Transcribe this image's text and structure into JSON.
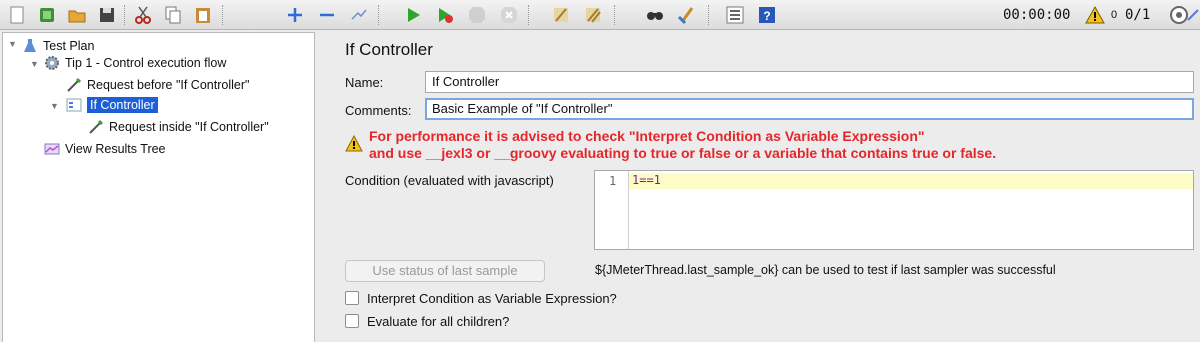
{
  "toolbar": {
    "icons": [
      "new-icon",
      "templates-icon",
      "open-icon",
      "save-icon",
      "cut-icon",
      "copy-icon",
      "paste-icon",
      "expand-icon",
      "collapse-icon",
      "toggle-icon",
      "start-icon",
      "start-no-pause-icon",
      "stop-icon",
      "shutdown-icon",
      "clear-icon",
      "clear-all-icon",
      "search-icon",
      "reset-search-icon",
      "function-helper-icon",
      "help-icon"
    ],
    "timer": "00:00:00",
    "warning_count": "0",
    "threads": "0/1"
  },
  "tree": {
    "items": [
      {
        "label": "Test Plan"
      },
      {
        "label": "Tip 1 - Control execution flow"
      },
      {
        "label": "Request before \"If Controller\""
      },
      {
        "label": "If Controller",
        "selected": true
      },
      {
        "label": "Request inside \"If Controller\""
      },
      {
        "label": "View Results Tree"
      }
    ]
  },
  "panel": {
    "title": "If Controller",
    "name_label": "Name:",
    "name_value": "If Controller",
    "comments_label": "Comments:",
    "comments_value": "Basic Example of \"If Controller\"",
    "warning_line1": "For performance it is advised to check \"Interpret Condition as Variable Expression\"",
    "warning_line2": "and use __jexl3 or __groovy evaluating to true or false or a variable that contains true or false.",
    "condition_label": "Condition (evaluated with javascript)",
    "condition_line_number": "1",
    "condition_code": "1==1",
    "use_status_button": "Use status of last sample",
    "hint_text": "${JMeterThread.last_sample_ok} can be used to test if last sampler was successful",
    "checkbox_interpret": "Interpret Condition as Variable Expression?",
    "checkbox_evaluate": "Evaluate for all children?"
  },
  "colors": {
    "selection": "#1c5fd6",
    "warning_text": "#e5262b",
    "current_line": "#fdfcc4",
    "code_text": "#7a1fa8"
  }
}
